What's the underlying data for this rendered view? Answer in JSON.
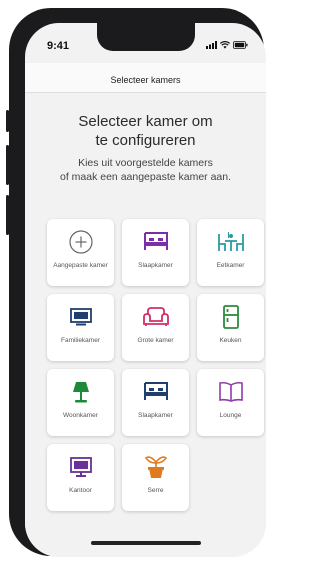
{
  "status": {
    "time": "9:41"
  },
  "nav": {
    "title": "Selecteer kamers"
  },
  "heading": {
    "line1": "Selecteer kamer om",
    "line2": "te configureren"
  },
  "subtitle": {
    "line1": "Kies uit voorgestelde kamers",
    "line2": "of maak een aangepaste kamer aan."
  },
  "rooms": [
    {
      "label": "Aangepaste kamer",
      "icon": "plus-circle-icon",
      "color": "#666666"
    },
    {
      "label": "Slaapkamer",
      "icon": "bed-icon",
      "color": "#7a2fa8"
    },
    {
      "label": "Eetkamer",
      "icon": "dining-table-icon",
      "color": "#2b9aa0"
    },
    {
      "label": "Familiekamer",
      "icon": "tv-icon",
      "color": "#1f3f6f"
    },
    {
      "label": "Grote kamer",
      "icon": "sofa-icon",
      "color": "#d22f68"
    },
    {
      "label": "Keuken",
      "icon": "fridge-icon",
      "color": "#2b8a3e"
    },
    {
      "label": "Woonkamer",
      "icon": "lamp-icon",
      "color": "#1d8a3a"
    },
    {
      "label": "Slaapkamer",
      "icon": "bed-icon",
      "color": "#1f3f6f"
    },
    {
      "label": "Lounge",
      "icon": "book-icon",
      "color": "#8a3fa8"
    },
    {
      "label": "Kantoor",
      "icon": "monitor-icon",
      "color": "#6a2f9a"
    },
    {
      "label": "Serre",
      "icon": "plant-icon",
      "color": "#e07a1f"
    }
  ]
}
